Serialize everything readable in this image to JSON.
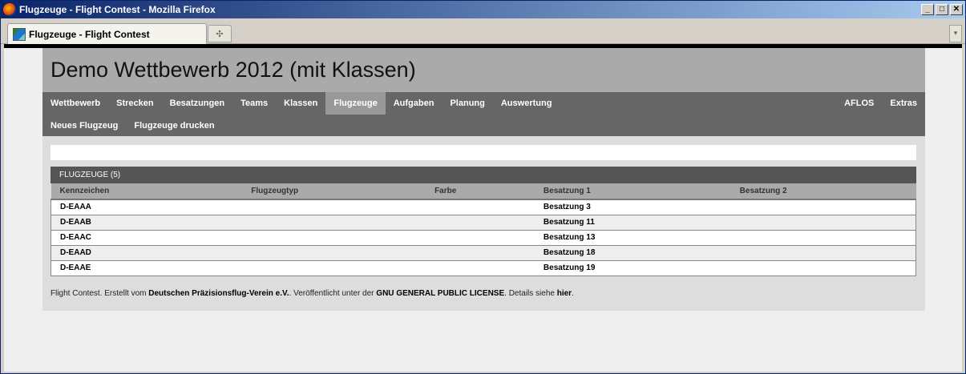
{
  "window": {
    "title": "Flugzeuge - Flight Contest - Mozilla Firefox",
    "minimize": "_",
    "maximize": "□",
    "close": "✕"
  },
  "tab": {
    "label": "Flugzeuge - Flight Contest",
    "newtab_glyph": "✣",
    "scroll_glyph": "▾"
  },
  "page": {
    "heading": "Demo Wettbewerb 2012 (mit Klassen)"
  },
  "nav": {
    "items": [
      "Wettbewerb",
      "Strecken",
      "Besatzungen",
      "Teams",
      "Klassen",
      "Flugzeuge",
      "Aufgaben",
      "Planung",
      "Auswertung"
    ],
    "active": "Flugzeuge",
    "right_items": [
      "AFLOS",
      "Extras"
    ]
  },
  "subnav": {
    "items": [
      "Neues Flugzeug",
      "Flugzeuge drucken"
    ]
  },
  "table": {
    "title": "FLUGZEUGE (5)",
    "columns": [
      "Kennzeichen",
      "Flugzeugtyp",
      "Farbe",
      "Besatzung 1",
      "Besatzung 2"
    ],
    "rows": [
      [
        "D-EAAA",
        "",
        "",
        "Besatzung 3",
        ""
      ],
      [
        "D-EAAB",
        "",
        "",
        "Besatzung 11",
        ""
      ],
      [
        "D-EAAC",
        "",
        "",
        "Besatzung 13",
        ""
      ],
      [
        "D-EAAD",
        "",
        "",
        "Besatzung 18",
        ""
      ],
      [
        "D-EAAE",
        "",
        "",
        "Besatzung 19",
        ""
      ]
    ]
  },
  "footer": {
    "text1": "Flight Contest. Erstellt vom ",
    "org": "Deutschen Präzisionsflug-Verein e.V.",
    "text2": ". Veröffentlicht unter der ",
    "license": "GNU GENERAL PUBLIC LICENSE",
    "text3": ". Details siehe ",
    "link": "hier",
    "text4": "."
  }
}
